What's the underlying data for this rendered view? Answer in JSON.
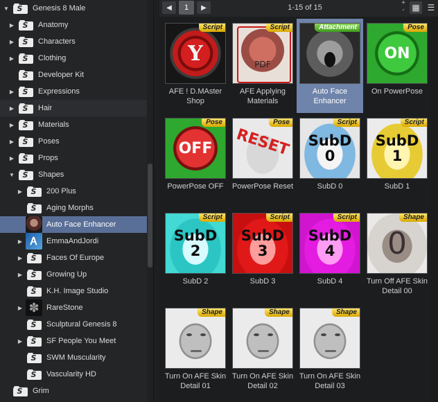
{
  "tree": {
    "items": [
      {
        "label": "Genesis 8 Male",
        "arrow": "▼",
        "icon": "folder-icon",
        "level": 0
      },
      {
        "label": "Anatomy",
        "arrow": "▶",
        "icon": "folder-icon",
        "level": 1
      },
      {
        "label": "Characters",
        "arrow": "▶",
        "icon": "folder-icon",
        "level": 1
      },
      {
        "label": "Clothing",
        "arrow": "▶",
        "icon": "folder-icon",
        "level": 1
      },
      {
        "label": "Developer Kit",
        "arrow": "",
        "icon": "folder-icon",
        "level": 1
      },
      {
        "label": "Expressions",
        "arrow": "▶",
        "icon": "folder-icon",
        "level": 1
      },
      {
        "label": "Hair",
        "arrow": "▶",
        "icon": "folder-icon",
        "level": 1
      },
      {
        "label": "Materials",
        "arrow": "▶",
        "icon": "folder-icon",
        "level": 1
      },
      {
        "label": "Poses",
        "arrow": "▶",
        "icon": "folder-icon",
        "level": 1
      },
      {
        "label": "Props",
        "arrow": "▶",
        "icon": "folder-icon",
        "level": 1
      },
      {
        "label": "Shapes",
        "arrow": "▼",
        "icon": "folder-icon",
        "level": 1
      },
      {
        "label": "200 Plus",
        "arrow": "▶",
        "icon": "folder-icon",
        "level": 2
      },
      {
        "label": "Aging Morphs",
        "arrow": "",
        "icon": "folder-icon",
        "level": 2
      },
      {
        "label": "Auto Face Enhancer",
        "arrow": "",
        "icon": "afe-thumbnail-icon",
        "level": 2
      },
      {
        "label": "EmmaAndJordi",
        "arrow": "▶",
        "icon": "emma-jordi-logo-icon",
        "level": 2
      },
      {
        "label": "Faces Of Europe",
        "arrow": "▶",
        "icon": "folder-icon",
        "level": 2
      },
      {
        "label": "Growing Up",
        "arrow": "▶",
        "icon": "folder-icon",
        "level": 2
      },
      {
        "label": "K.H. Image Studio",
        "arrow": "",
        "icon": "folder-icon",
        "level": 2
      },
      {
        "label": "RareStone",
        "arrow": "▶",
        "icon": "rarestone-logo-icon",
        "level": 2
      },
      {
        "label": "Sculptural Genesis 8",
        "arrow": "",
        "icon": "folder-icon",
        "level": 2
      },
      {
        "label": "SF People You Meet",
        "arrow": "▶",
        "icon": "folder-icon",
        "level": 2
      },
      {
        "label": "SWM Muscularity",
        "arrow": "",
        "icon": "folder-icon",
        "level": 2
      },
      {
        "label": "Vascularity HD",
        "arrow": "",
        "icon": "folder-icon",
        "level": 2
      },
      {
        "label": "Grim",
        "arrow": "",
        "icon": "folder-icon",
        "level": 0
      }
    ],
    "selected_label": "Auto Face Enhancer",
    "hovered_label": "Hair"
  },
  "header": {
    "prev_icon": "◀",
    "next_icon": "▶",
    "page": "1",
    "count_text": "1-15 of 15",
    "plus": "+",
    "minus": "-",
    "grid_view_icon": "▦",
    "list_view_icon": "☰"
  },
  "products": [
    {
      "caption": "AFE ! D.MAster Shop",
      "badge": "Script",
      "art": "red-y",
      "art_text": "Y"
    },
    {
      "caption": "AFE Applying Materials",
      "badge": "Script",
      "art": "pdf",
      "art_text": "PDF"
    },
    {
      "caption": "Auto Face Enhancer",
      "badge": "Attachment",
      "art": "scream",
      "art_text": "",
      "selected": true
    },
    {
      "caption": "On PowerPose",
      "badge": "Pose",
      "art": "green-on",
      "art_text": "ON"
    },
    {
      "caption": "PowerPose OFF",
      "badge": "Pose",
      "art": "red-off",
      "art_text": "OFF"
    },
    {
      "caption": "PowerPose Reset",
      "badge": "Pose",
      "art": "reset",
      "art_text": "RESET"
    },
    {
      "caption": "SubD 0",
      "badge": "Script",
      "art": "subd s0",
      "art_text": "SubD",
      "art_num": "0"
    },
    {
      "caption": "SubD 1",
      "badge": "Script",
      "art": "subd s1",
      "art_text": "SubD",
      "art_num": "1"
    },
    {
      "caption": "SubD 2",
      "badge": "Script",
      "art": "subd s2",
      "art_text": "SubD",
      "art_num": "2"
    },
    {
      "caption": "SubD 3",
      "badge": "Script",
      "art": "subd s3",
      "art_text": "SubD",
      "art_num": "3"
    },
    {
      "caption": "SubD 4",
      "badge": "Script",
      "art": "subd s4",
      "art_text": "SubD",
      "art_num": "4"
    },
    {
      "caption": "Turn Off AFE Skin Detail 00",
      "badge": "Shape",
      "art": "blur0",
      "art_text": "0"
    },
    {
      "caption": "Turn On AFE Skin Detail 01",
      "badge": "Shape",
      "art": "face",
      "art_text": ""
    },
    {
      "caption": "Turn On AFE Skin Detail 02",
      "badge": "Shape",
      "art": "face",
      "art_text": ""
    },
    {
      "caption": "Turn On AFE Skin Detail 03",
      "badge": "Shape",
      "art": "face",
      "art_text": ""
    }
  ]
}
